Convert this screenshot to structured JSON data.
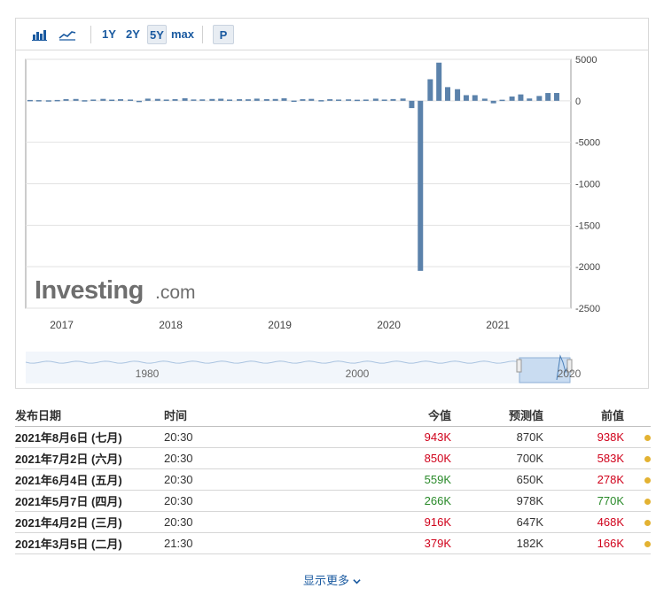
{
  "toolbar": {
    "bar_chart_icon": "bar-chart-icon",
    "area_chart_icon": "area-chart-icon",
    "ranges": [
      "1Y",
      "2Y",
      "5Y",
      "max"
    ],
    "active_range": "5Y",
    "p_label": "P"
  },
  "chart_data": {
    "type": "bar",
    "y_ticks": [
      "5000",
      "0",
      "-5000",
      "-1000",
      "-1500",
      "-2000",
      "-2500"
    ],
    "x_ticks": [
      "2017",
      "2018",
      "2019",
      "2020",
      "2021"
    ],
    "ylim": [
      -25000,
      5000
    ],
    "x_start_year": 2016.67,
    "x_end_year": 2021.67,
    "bars": [
      {
        "x": 2016.71,
        "value": 100
      },
      {
        "x": 2016.79,
        "value": 80
      },
      {
        "x": 2016.88,
        "value": 60
      },
      {
        "x": 2016.96,
        "value": 100
      },
      {
        "x": 2017.04,
        "value": 200
      },
      {
        "x": 2017.13,
        "value": 220
      },
      {
        "x": 2017.21,
        "value": 70
      },
      {
        "x": 2017.29,
        "value": 150
      },
      {
        "x": 2017.38,
        "value": 230
      },
      {
        "x": 2017.46,
        "value": 140
      },
      {
        "x": 2017.54,
        "value": 190
      },
      {
        "x": 2017.63,
        "value": 150
      },
      {
        "x": 2017.71,
        "value": -30
      },
      {
        "x": 2017.79,
        "value": 260
      },
      {
        "x": 2017.88,
        "value": 230
      },
      {
        "x": 2017.96,
        "value": 150
      },
      {
        "x": 2018.04,
        "value": 200
      },
      {
        "x": 2018.13,
        "value": 310
      },
      {
        "x": 2018.21,
        "value": 160
      },
      {
        "x": 2018.29,
        "value": 170
      },
      {
        "x": 2018.38,
        "value": 220
      },
      {
        "x": 2018.46,
        "value": 250
      },
      {
        "x": 2018.54,
        "value": 150
      },
      {
        "x": 2018.63,
        "value": 190
      },
      {
        "x": 2018.71,
        "value": 180
      },
      {
        "x": 2018.79,
        "value": 260
      },
      {
        "x": 2018.88,
        "value": 200
      },
      {
        "x": 2018.96,
        "value": 220
      },
      {
        "x": 2019.04,
        "value": 300
      },
      {
        "x": 2019.13,
        "value": 30
      },
      {
        "x": 2019.21,
        "value": 190
      },
      {
        "x": 2019.29,
        "value": 230
      },
      {
        "x": 2019.38,
        "value": 80
      },
      {
        "x": 2019.46,
        "value": 190
      },
      {
        "x": 2019.54,
        "value": 150
      },
      {
        "x": 2019.63,
        "value": 170
      },
      {
        "x": 2019.71,
        "value": 130
      },
      {
        "x": 2019.79,
        "value": 150
      },
      {
        "x": 2019.88,
        "value": 260
      },
      {
        "x": 2019.96,
        "value": 150
      },
      {
        "x": 2020.04,
        "value": 210
      },
      {
        "x": 2020.13,
        "value": 270
      },
      {
        "x": 2020.21,
        "value": -880
      },
      {
        "x": 2020.29,
        "value": -20500
      },
      {
        "x": 2020.38,
        "value": 2600
      },
      {
        "x": 2020.46,
        "value": 4600
      },
      {
        "x": 2020.54,
        "value": 1650
      },
      {
        "x": 2020.63,
        "value": 1400
      },
      {
        "x": 2020.71,
        "value": 680
      },
      {
        "x": 2020.79,
        "value": 680
      },
      {
        "x": 2020.88,
        "value": 260
      },
      {
        "x": 2020.96,
        "value": -300
      },
      {
        "x": 2021.04,
        "value": 130
      },
      {
        "x": 2021.13,
        "value": 520
      },
      {
        "x": 2021.21,
        "value": 770
      },
      {
        "x": 2021.29,
        "value": 278
      },
      {
        "x": 2021.38,
        "value": 583
      },
      {
        "x": 2021.46,
        "value": 938
      },
      {
        "x": 2021.54,
        "value": 943
      }
    ],
    "watermark": {
      "brand": "Investing",
      "suffix": ".com"
    },
    "navigator_labels": [
      "1980",
      "2000",
      "2020"
    ],
    "bar_color": "#5b82ab"
  },
  "table": {
    "headers": {
      "date": "发布日期",
      "time": "时间",
      "actual": "今值",
      "forecast": "预测值",
      "previous": "前值"
    },
    "rows": [
      {
        "date": "2021年8月6日 (七月)",
        "time": "20:30",
        "actual": "943K",
        "actual_color": "red",
        "forecast": "870K",
        "previous": "938K",
        "previous_color": "red"
      },
      {
        "date": "2021年7月2日 (六月)",
        "time": "20:30",
        "actual": "850K",
        "actual_color": "red",
        "forecast": "700K",
        "previous": "583K",
        "previous_color": "red"
      },
      {
        "date": "2021年6月4日 (五月)",
        "time": "20:30",
        "actual": "559K",
        "actual_color": "green",
        "forecast": "650K",
        "previous": "278K",
        "previous_color": "red"
      },
      {
        "date": "2021年5月7日 (四月)",
        "time": "20:30",
        "actual": "266K",
        "actual_color": "green",
        "forecast": "978K",
        "previous": "770K",
        "previous_color": "green"
      },
      {
        "date": "2021年4月2日 (三月)",
        "time": "20:30",
        "actual": "916K",
        "actual_color": "red",
        "forecast": "647K",
        "previous": "468K",
        "previous_color": "red"
      },
      {
        "date": "2021年3月5日 (二月)",
        "time": "21:30",
        "actual": "379K",
        "actual_color": "red",
        "forecast": "182K",
        "previous": "166K",
        "previous_color": "red"
      }
    ]
  },
  "show_more": "显示更多"
}
